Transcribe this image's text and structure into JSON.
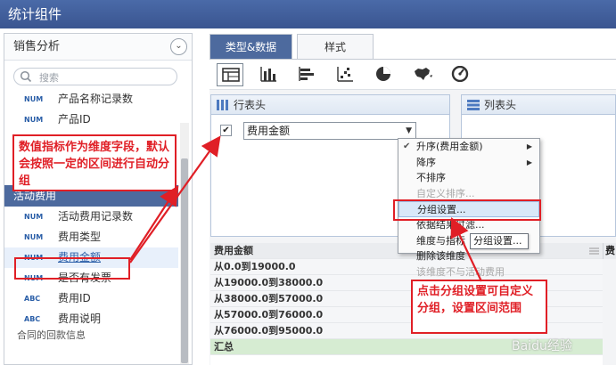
{
  "title": "统计组件",
  "left_panel": {
    "header": "销售分析",
    "search_placeholder": "搜索",
    "items_top": [
      {
        "tag": "NUM",
        "label": "产品名称记录数"
      },
      {
        "tag": "NUM",
        "label": "产品ID"
      }
    ],
    "group_header": "活动费用",
    "items": [
      {
        "tag": "NUM",
        "label": "活动费用记录数"
      },
      {
        "tag": "NUM",
        "label": "费用类型"
      },
      {
        "tag": "NUM",
        "label": "费用金额"
      },
      {
        "tag": "NUM",
        "label": "是否有发票"
      },
      {
        "tag": "ABC",
        "label": "费用ID"
      },
      {
        "tag": "ABC",
        "label": "费用说明"
      }
    ],
    "cut_item": "合同的回款信息"
  },
  "tabs": [
    {
      "label": "类型&数据",
      "active": true
    },
    {
      "label": "样式",
      "active": false
    }
  ],
  "chart_icons": [
    "table-icon",
    "bar-chart-icon",
    "horizontal-bar-icon",
    "scatter-icon",
    "pie-chart-icon",
    "map-icon",
    "gauge-icon"
  ],
  "row_header": {
    "title": "行表头",
    "field": "费用金额"
  },
  "col_header": {
    "title": "列表头"
  },
  "context_menu": {
    "items": [
      {
        "label": "升序(费用金额)",
        "checked": true,
        "submenu": true,
        "disabled": false
      },
      {
        "label": "降序",
        "checked": false,
        "submenu": true,
        "disabled": false
      },
      {
        "label": "不排序",
        "checked": false,
        "submenu": false,
        "disabled": false
      },
      {
        "label": "自定义排序...",
        "checked": false,
        "submenu": false,
        "disabled": true
      },
      {
        "label": "分组设置...",
        "checked": false,
        "submenu": false,
        "disabled": false,
        "highlight": true
      },
      {
        "label": "依据结果过滤...",
        "checked": false,
        "submenu": false,
        "disabled": false
      },
      {
        "label": "维度与指标",
        "checked": false,
        "submenu": false,
        "disabled": false
      },
      {
        "label": "删除该维度",
        "checked": false,
        "submenu": false,
        "disabled": false
      },
      {
        "label": "该维度不与活动费用",
        "checked": false,
        "submenu": false,
        "disabled": true
      }
    ],
    "tooltip": "分组设置..."
  },
  "table": {
    "header": "费用金额",
    "header_right": "费",
    "rows": [
      "从0.0到19000.0",
      "从19000.0到38000.0",
      "从38000.0到57000.0",
      "从57000.0到76000.0",
      "从76000.0到95000.0"
    ],
    "summary": "汇总"
  },
  "callouts": {
    "one": "数值指标作为维度字段，默认会按照一定的区间进行自动分组",
    "two": "点击分组设置可自定义分组，设置区间范围"
  },
  "watermark": "Baidu经验",
  "colors": {
    "titlebar": "#3a5590",
    "accent": "#4d6a9e",
    "callout_red": "#e01f26",
    "summary_green": "#d6ecd2"
  }
}
